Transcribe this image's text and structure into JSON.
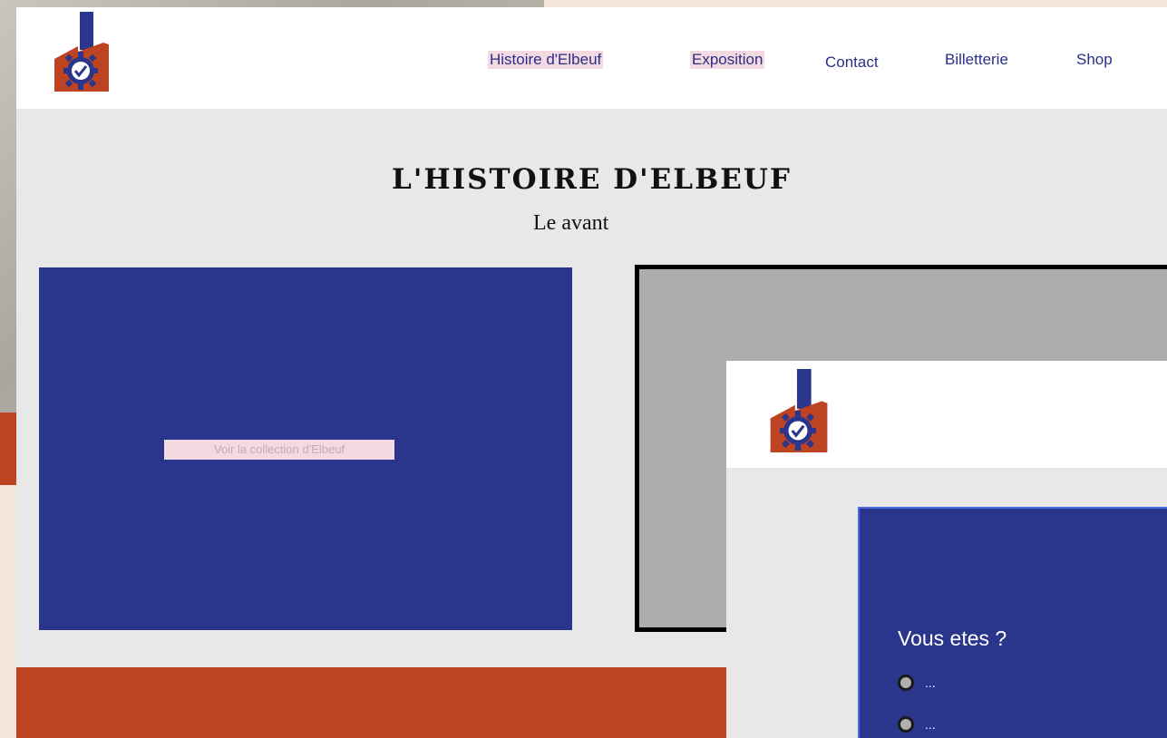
{
  "nav": {
    "items": [
      {
        "label": "Histoire d'Elbeuf"
      },
      {
        "label": "Exposition"
      },
      {
        "label": "Contact"
      },
      {
        "label": "Billetterie"
      },
      {
        "label": "Shop"
      }
    ]
  },
  "main": {
    "title": "L'HISTOIRE D'ELBEUF",
    "subtitle": "Le avant",
    "card_label": "Voir la collection d'Elbeuf"
  },
  "popup": {
    "question": "Vous etes ?",
    "options": [
      {
        "label": "..."
      },
      {
        "label": "..."
      }
    ]
  },
  "colors": {
    "brand_blue": "#2a358c",
    "brand_red": "#bd4322",
    "nav_highlight": "#f3d9e2",
    "frame_gray": "#adadad"
  },
  "icons": {
    "logo": "factory-clock-gear-logo",
    "option": "radio-button"
  }
}
